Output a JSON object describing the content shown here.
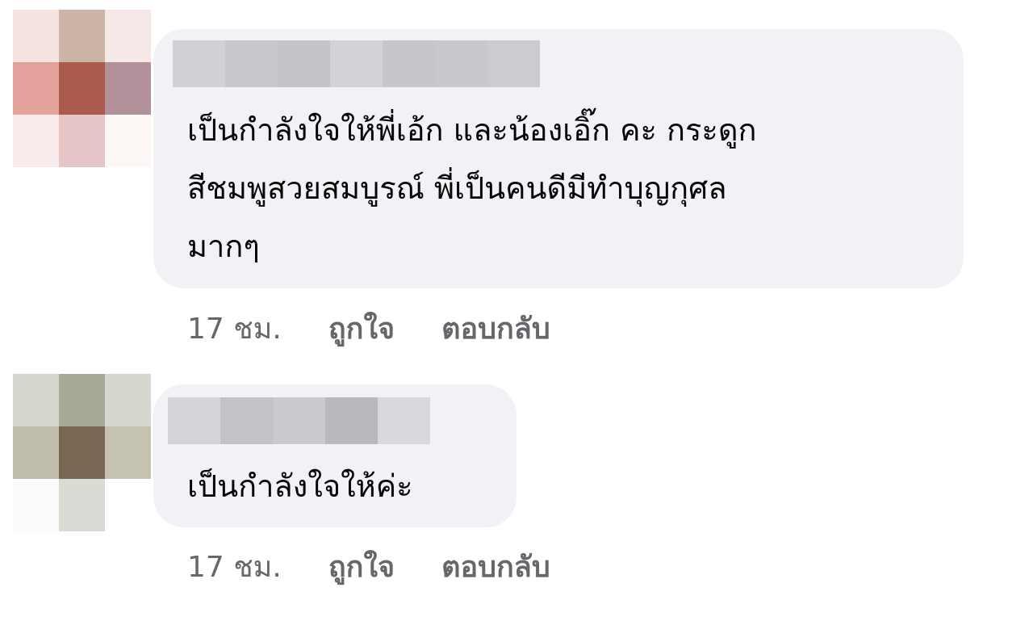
{
  "comments": [
    {
      "text": "เป็นกำลังใจให้พี่เอ้ก และน้องเอิ๊ก คะ กระดูก\nสีชมพูสวยสมบูรณ์ พี่เป็นคนดีมีทำบุญกุศล\nมากๆ",
      "time": "17 ชม.",
      "like_label": "ถูกใจ",
      "reply_label": "ตอบกลับ",
      "avatar_colors": [
        "#f6e3e2",
        "#ccb4a6",
        "#f5e8e7",
        "#e3a29c",
        "#ab5b4c",
        "#b2909a",
        "#f8ebec",
        "#e6c5c7",
        "#fdf8f6"
      ],
      "name_blur_colors": [
        "#d0d0d6",
        "#c7c7cc",
        "#c4c4ca",
        "#d2d2d8",
        "#c6c6cc",
        "#c8c8ce",
        "#cbcbd1"
      ]
    },
    {
      "text": "เป็นกำลังใจให้ค่ะ",
      "time": "17 ชม.",
      "like_label": "ถูกใจ",
      "reply_label": "ตอบกลับ",
      "avatar_colors": [
        "#d6d5cd",
        "#a8a994",
        "#d6d8d0",
        "#c0bcaa",
        "#796653",
        "#c5c2b1",
        "#fbfbfb",
        "#dadbd5",
        "#ffffff"
      ],
      "name_blur_colors": [
        "#d4d4da",
        "#c2c2c8",
        "#c9c9cf",
        "#b8b8bf",
        "#d8d8de"
      ]
    }
  ]
}
